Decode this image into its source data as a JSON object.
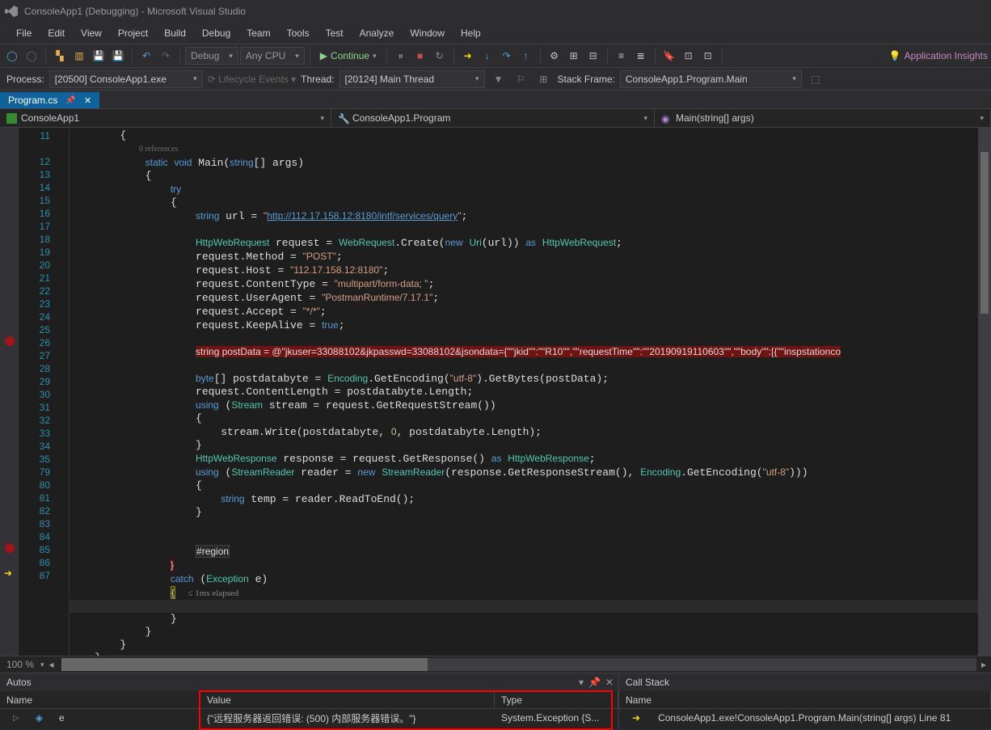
{
  "title": "ConsoleApp1 (Debugging) - Microsoft Visual Studio",
  "menu": [
    "File",
    "Edit",
    "View",
    "Project",
    "Build",
    "Debug",
    "Team",
    "Tools",
    "Test",
    "Analyze",
    "Window",
    "Help"
  ],
  "toolbar": {
    "config": "Debug",
    "platform": "Any CPU",
    "continue": "Continue",
    "app_insights": "Application Insights"
  },
  "debugbar": {
    "process_label": "Process:",
    "process": "[20500] ConsoleApp1.exe",
    "lifecycle": "Lifecycle Events",
    "thread_label": "Thread:",
    "thread": "[20124] Main Thread",
    "stackframe_label": "Stack Frame:",
    "stackframe": "ConsoleApp1.Program.Main"
  },
  "tab": "Program.cs",
  "nav": {
    "project": "ConsoleApp1",
    "class": "ConsoleApp1.Program",
    "method": "Main(string[] args)"
  },
  "codelens": "0 references",
  "timing": "≤ 1ms elapsed",
  "region_label": "#region",
  "line_numbers": [
    "11",
    "12",
    "13",
    "14",
    "15",
    "16",
    "17",
    "18",
    "19",
    "20",
    "21",
    "22",
    "23",
    "24",
    "25",
    "26",
    "27",
    "28",
    "29",
    "30",
    "31",
    "32",
    "33",
    "34",
    "35",
    "79",
    "80",
    "81",
    "82",
    "83",
    "84",
    "85",
    "86",
    "87"
  ],
  "code": {
    "url": "http://112.17.158.12:8180/intf/services/query",
    "post": "POST",
    "host": "112.17.158.12:8180",
    "content_type": "multipart/form-data; ",
    "user_agent": "PostmanRuntime/7.17.1",
    "accept": "*/*",
    "postdata": "string postData = @\"jkuser=33088102&jkpasswd=33088102&jsondata={\"\"jkid\"\":\"\"R10\"\",\"\"requestTime\"\":\"\"20190919110603\"\",\"\"body\"\":[{\"\"inspstationco",
    "utf8_1": "utf-8",
    "utf8_2": "utf-8"
  },
  "zoom": "100 %",
  "autos": {
    "title": "Autos",
    "col_name": "Name",
    "col_value": "Value",
    "col_type": "Type",
    "row_name": "e",
    "row_value": "{\"远程服务器返回错误: (500) 内部服务器错误。\"}",
    "row_type": "System.Exception {S..."
  },
  "callstack": {
    "title": "Call Stack",
    "col_name": "Name",
    "row": "ConsoleApp1.exe!ConsoleApp1.Program.Main(string[] args) Line 81"
  }
}
